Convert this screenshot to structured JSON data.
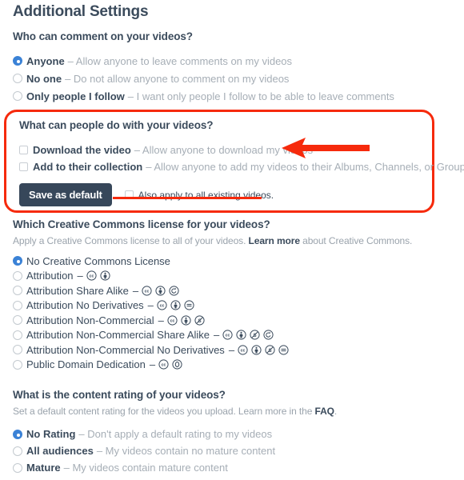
{
  "page": {
    "title": "Additional Settings"
  },
  "comments": {
    "heading": "Who can comment on your videos?",
    "options": [
      {
        "label": "Anyone",
        "desc": "– Allow anyone to leave comments on my videos",
        "selected": true
      },
      {
        "label": "No one",
        "desc": "– Do not allow anyone to comment on my videos",
        "selected": false
      },
      {
        "label": "Only people I follow",
        "desc": "– I want only people I follow to be able to leave comments",
        "selected": false
      }
    ]
  },
  "permissions": {
    "heading": "What can people do with your videos?",
    "checkboxes": [
      {
        "label": "Download the video",
        "desc": "– Allow anyone to download my videos",
        "checked": false
      },
      {
        "label": "Add to their collection",
        "desc": "– Allow anyone to add my videos to their Albums, Channels, or Groups",
        "checked": false
      }
    ],
    "save_label": "Save as default",
    "apply_all_label": "Also apply to all existing videos.",
    "apply_all_checked": false,
    "highlight_color": "#f62a0c",
    "arrow_color": "#f62a0c"
  },
  "creative_commons": {
    "heading": "Which Creative Commons license for your videos?",
    "sub_before": "Apply a Creative Commons license to all of your videos.",
    "sub_link": "Learn more",
    "sub_after": "about Creative Commons.",
    "options": [
      {
        "label": "No Creative Commons License",
        "selected": true,
        "icons": []
      },
      {
        "label": "Attribution",
        "selected": false,
        "icons": [
          "cc",
          "by"
        ]
      },
      {
        "label": "Attribution Share Alike",
        "selected": false,
        "icons": [
          "cc",
          "by",
          "sa"
        ]
      },
      {
        "label": "Attribution No Derivatives",
        "selected": false,
        "icons": [
          "cc",
          "by",
          "nd"
        ]
      },
      {
        "label": "Attribution Non-Commercial",
        "selected": false,
        "icons": [
          "cc",
          "by",
          "nc"
        ]
      },
      {
        "label": "Attribution Non-Commercial Share Alike",
        "selected": false,
        "icons": [
          "cc",
          "by",
          "nc",
          "sa"
        ]
      },
      {
        "label": "Attribution Non-Commercial No Derivatives",
        "selected": false,
        "icons": [
          "cc",
          "by",
          "nc",
          "nd"
        ]
      },
      {
        "label": "Public Domain Dedication",
        "selected": false,
        "icons": [
          "cc",
          "zero"
        ]
      }
    ],
    "dash": "–"
  },
  "content_rating": {
    "heading": "What is the content rating of your videos?",
    "sub_before": "Set a default content rating for the videos you upload. Learn more in the",
    "sub_link": "FAQ",
    "sub_after": ".",
    "options": [
      {
        "label": "No Rating",
        "desc": "– Don't apply a default rating to my videos",
        "selected": true
      },
      {
        "label": "All audiences",
        "desc": "– My videos contain no mature content",
        "selected": false
      },
      {
        "label": "Mature",
        "desc": "– My videos contain mature content",
        "selected": false
      }
    ]
  },
  "colors": {
    "accent_blue": "#3b82d6",
    "heading": "#3b4b5c",
    "muted": "#a6aeb6",
    "highlight_red": "#f62a0c",
    "button_bg": "#37475a"
  }
}
